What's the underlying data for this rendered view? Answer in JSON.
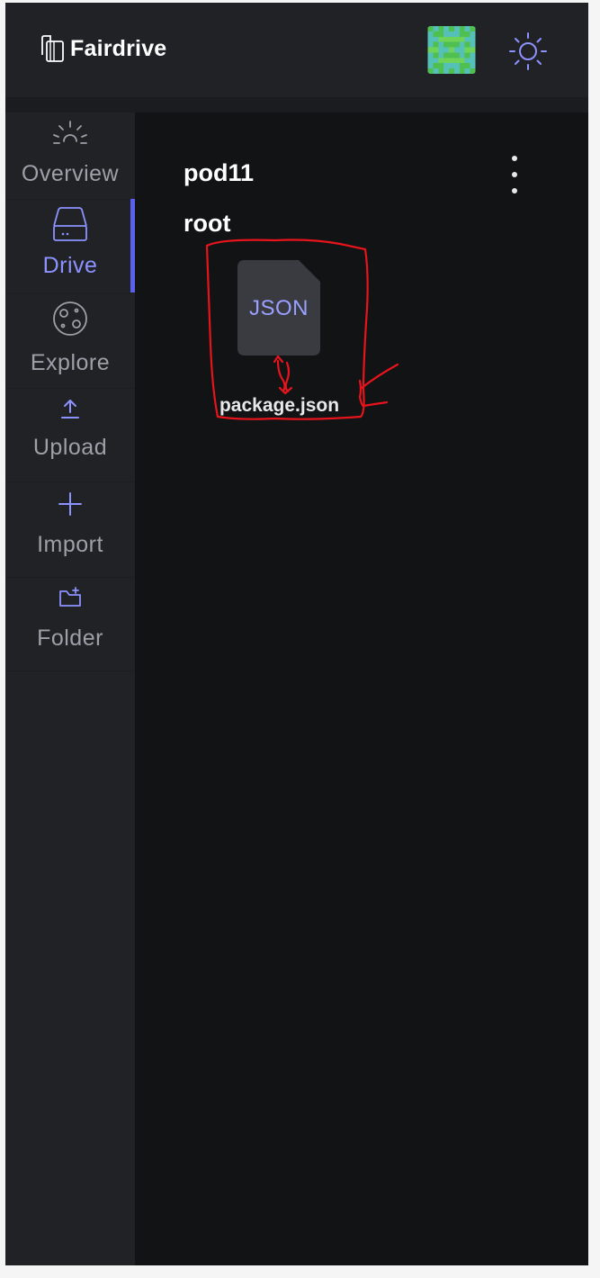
{
  "app": {
    "name": "Fairdrive"
  },
  "header": {
    "logo_icon": "fairdrive-logo-icon",
    "avatar_icon": "pixel-avatar",
    "theme_icon": "sun-icon"
  },
  "sidebar": {
    "items": [
      {
        "label": "Overview",
        "icon": "sunrise-icon",
        "active": false
      },
      {
        "label": "Drive",
        "icon": "hard-drive-icon",
        "active": true
      },
      {
        "label": "Explore",
        "icon": "planet-icon",
        "active": false
      },
      {
        "label": "Upload",
        "icon": "upload-icon",
        "active": false
      },
      {
        "label": "Import",
        "icon": "plus-icon",
        "active": false
      },
      {
        "label": "Folder",
        "icon": "new-folder-icon",
        "active": false
      }
    ]
  },
  "main": {
    "pod_name": "pod11",
    "directory": "root",
    "files": [
      {
        "type_label": "JSON",
        "name": "package.json"
      }
    ]
  },
  "colors": {
    "accent": "#8c92ff",
    "active_bar": "#5b5ff0",
    "annotation": "#e8141c"
  }
}
